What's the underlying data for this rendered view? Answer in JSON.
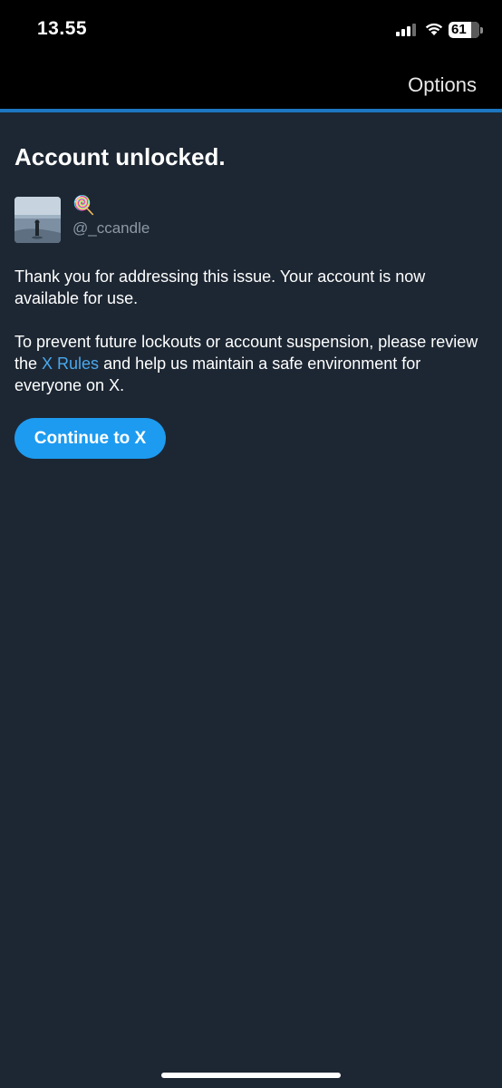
{
  "status_bar": {
    "time": "13.55",
    "battery_level": "61"
  },
  "navbar": {
    "options_label": "Options"
  },
  "page": {
    "title": "Account unlocked.",
    "display_name_emoji": "🍭",
    "username": "@_ccandle",
    "paragraph1": "Thank you for addressing this issue. Your account is now available for use.",
    "paragraph2_before": "To prevent future lockouts or account suspension, please review the ",
    "paragraph2_link": "X Rules",
    "paragraph2_after": " and help us maintain a safe environment for everyone on X.",
    "continue_label": "Continue to X"
  },
  "colors": {
    "background": "#1d2733",
    "accent": "#1d9bf0",
    "link": "#4aa8ee",
    "divider": "#1d76c0",
    "muted_text": "#8b98a5"
  }
}
